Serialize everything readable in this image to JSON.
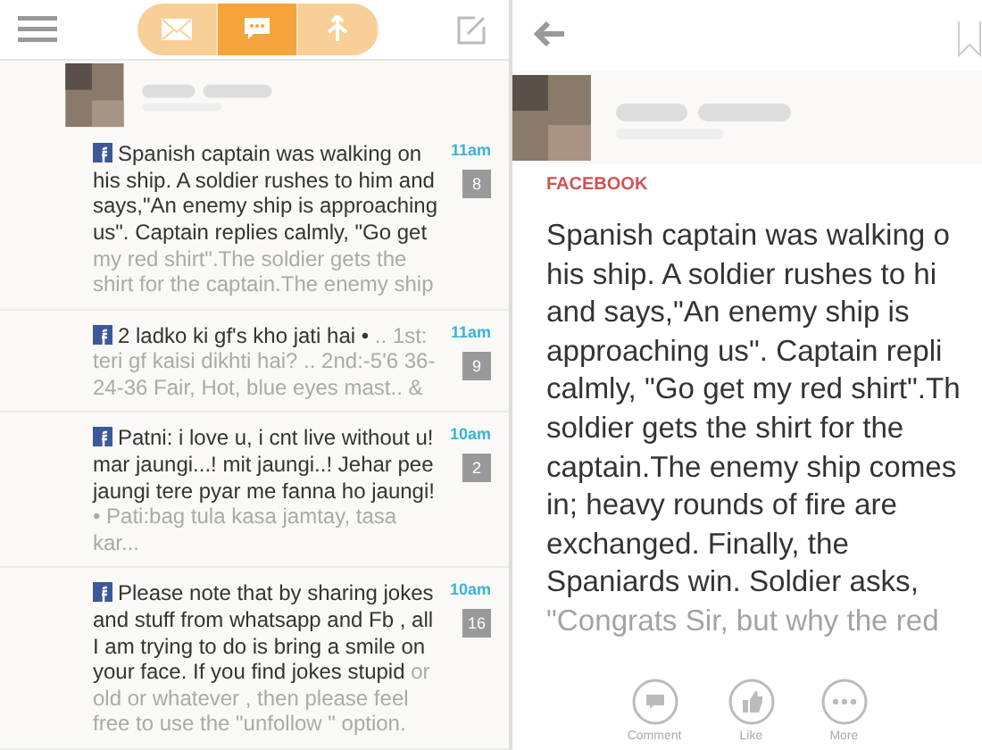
{
  "feed": {
    "tabs": [
      {
        "kind": "mail",
        "selected": false
      },
      {
        "kind": "chat",
        "selected": true
      },
      {
        "kind": "fork",
        "selected": false
      }
    ],
    "posts": [
      {
        "title": "Spanish captain was walking on his ship. A soldier rushes to him and says,\"An enemy ship is approaching us\". Captain replies calmly, \"Go get",
        "snippet": "my red shirt\".The soldier gets the shirt for the captain.The enemy ship",
        "time": "11am",
        "comments": "8"
      },
      {
        "title": "2 ladko ki gf's kho jati hai •",
        "snippet": ".. 1st: teri gf kaisi dikhti hai? .. 2nd:-5'6 36-24-36 Fair, Hot, blue eyes mast.. &",
        "time": "11am",
        "comments": "9"
      },
      {
        "title": "Patni: i love u, i cnt live without u! mar jaungi...! mit jaungi..! Jehar pee jaungi tere pyar me fanna ho jaungi!",
        "snippet": "• Pati:bag tula kasa jamtay, tasa kar...",
        "time": "10am",
        "comments": "2"
      },
      {
        "title": "Please note that by sharing jokes and stuff from whatsapp and Fb , all I am trying to do is bring a smile on your face. If you find jokes stupid",
        "snippet": "or old or whatever , then please feel free to use the \"unfollow \" option.",
        "time": "10am",
        "comments": "16"
      }
    ]
  },
  "detail": {
    "source": "FACEBOOK",
    "lines": [
      "Spanish captain was walking o",
      "his ship. A soldier rushes to hi",
      "and says,\"An enemy ship is",
      "approaching us\". Captain repli",
      "calmly, \"Go get my red shirt\".Th",
      "soldier gets the shirt for the",
      "captain.The enemy ship comes",
      "in; heavy rounds of fire are",
      "exchanged. Finally, the",
      "Spaniards win. Soldier asks,",
      "\"Congrats Sir, but why the red"
    ],
    "actions": [
      {
        "kind": "comment",
        "label": "Comment"
      },
      {
        "kind": "like",
        "label": "Like"
      },
      {
        "kind": "more",
        "label": "More"
      }
    ]
  }
}
